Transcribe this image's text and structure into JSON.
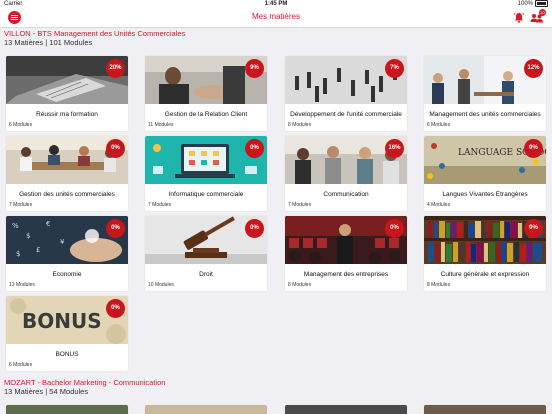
{
  "status": {
    "carrier": "Carrier",
    "time": "1:45 PM",
    "battery": "100%"
  },
  "nav": {
    "title": "Mes matières",
    "notif_count": "10"
  },
  "colors": {
    "accent": "#d8192a"
  },
  "sections": [
    {
      "title": "VILLON - BTS Management des Unités Commerciales",
      "subtitle": "13 Matières | 101 Modules",
      "courses": [
        {
          "name": "Réussir ma formation",
          "modules": "6 Modules",
          "pct": "20%"
        },
        {
          "name": "Gestion de la Relation Client",
          "modules": "11 Modules",
          "pct": "9%"
        },
        {
          "name": "Développement de l'unité commerciale",
          "modules": "8 Modules",
          "pct": "7%"
        },
        {
          "name": "Management des unités commerciales",
          "modules": "6 Modules",
          "pct": "12%"
        },
        {
          "name": "Gestion des unités commerciales",
          "modules": "7 Modules",
          "pct": "0%"
        },
        {
          "name": "Informatique commerciale",
          "modules": "7 Modules",
          "pct": "0%"
        },
        {
          "name": "Communication",
          "modules": "7 Modules",
          "pct": "16%"
        },
        {
          "name": "Langues Vivantes Etrangères",
          "modules": "4 Modules",
          "pct": "0%"
        },
        {
          "name": "Economie",
          "modules": "13 Modules",
          "pct": "0%"
        },
        {
          "name": "Droit",
          "modules": "10 Modules",
          "pct": "0%"
        },
        {
          "name": "Management des entreprises",
          "modules": "8 Modules",
          "pct": "0%"
        },
        {
          "name": "Culture générale et expression",
          "modules": "8 Modules",
          "pct": "0%"
        },
        {
          "name": "BONUS",
          "modules": "6 Modules",
          "pct": "0%"
        }
      ]
    },
    {
      "title": "MOZART - Bachelor Marketing - Communication",
      "subtitle": "13 Matières | 54 Modules"
    }
  ],
  "thumb_labels": {
    "language": "LANGUAGE SCHOOL",
    "bonus": "BONUS"
  }
}
